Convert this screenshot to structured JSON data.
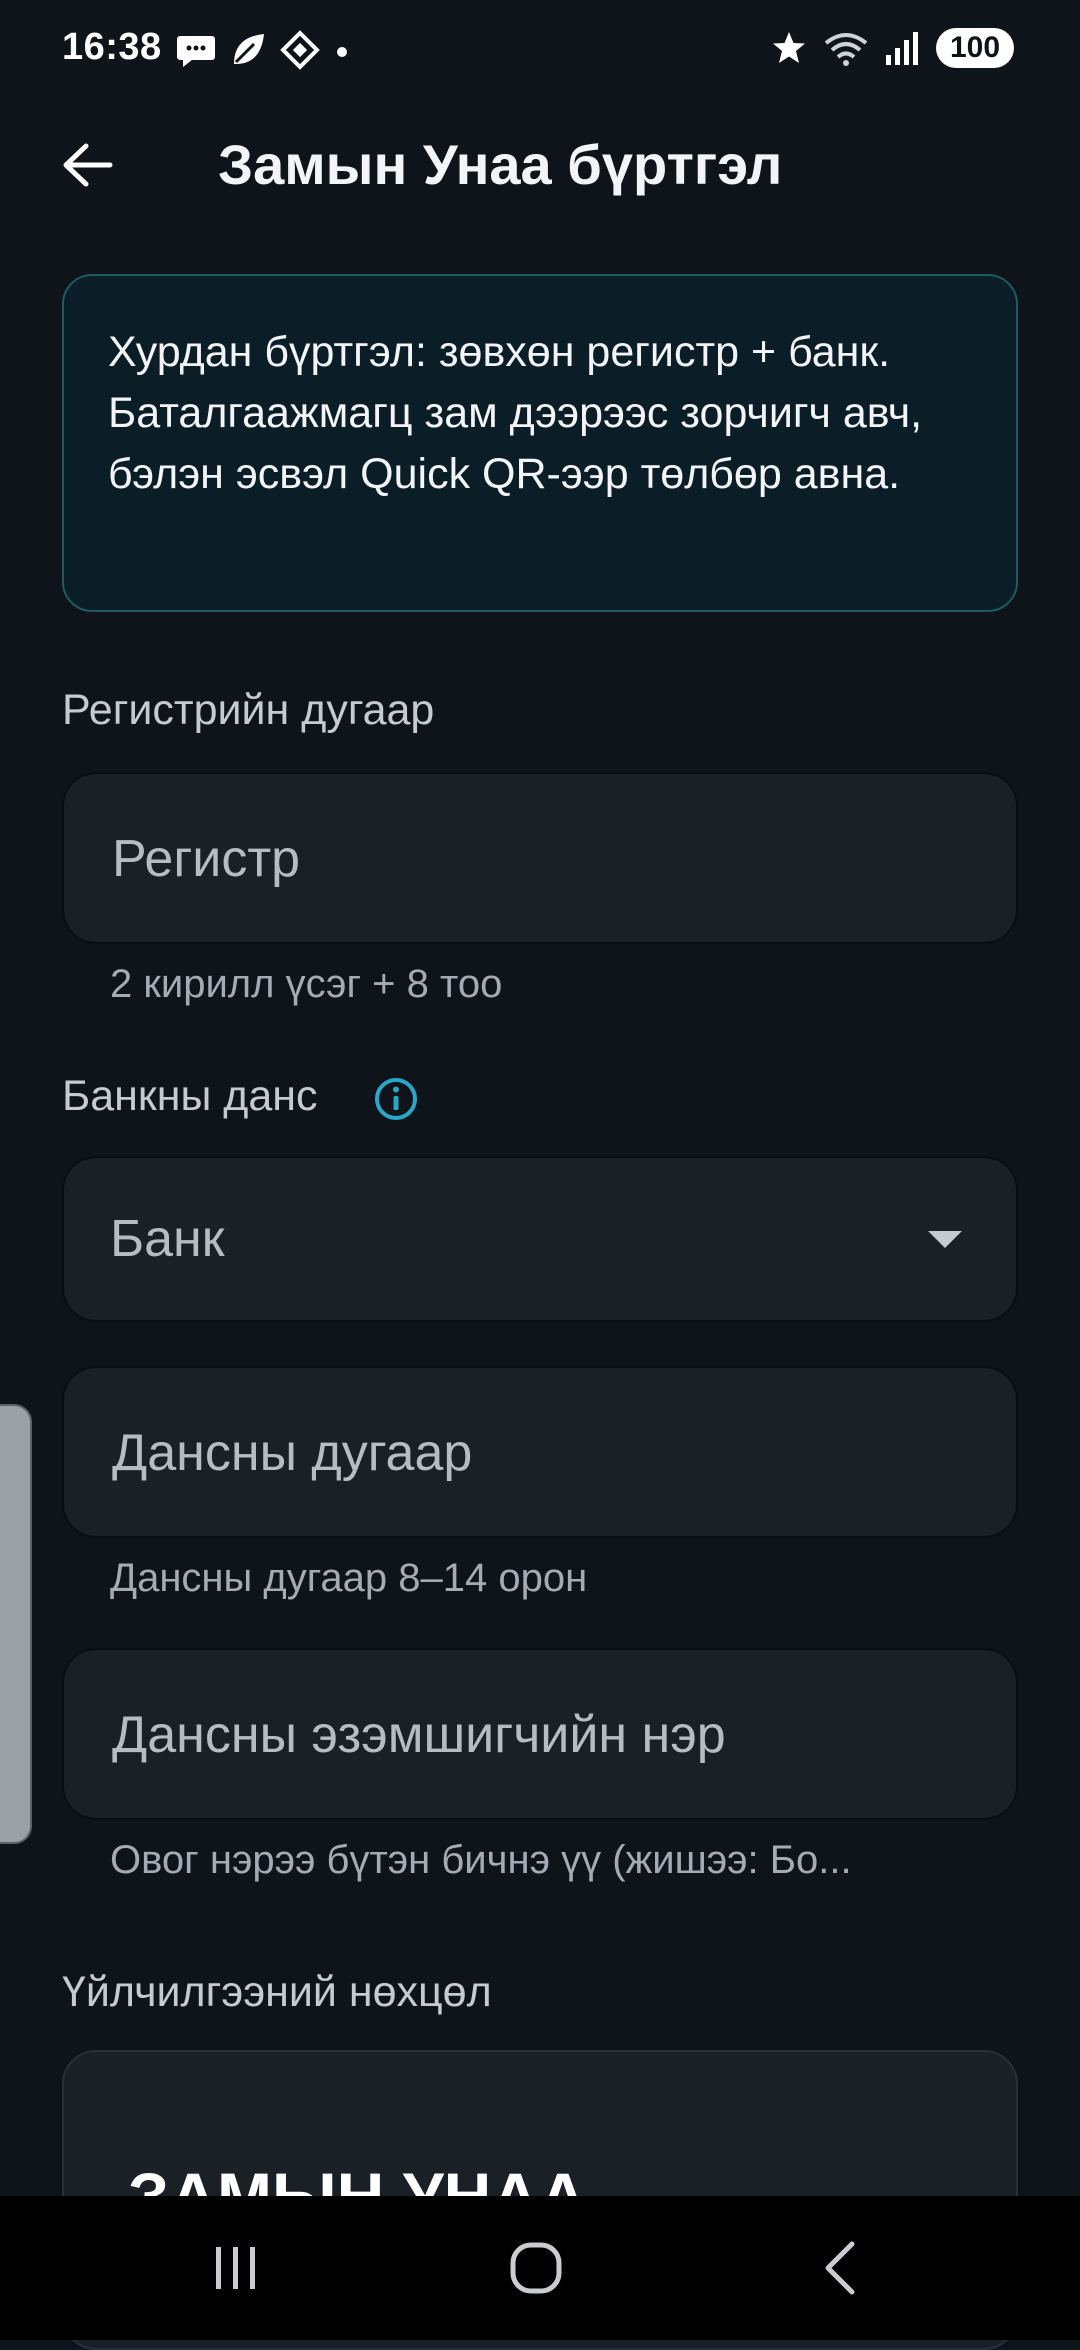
{
  "status_bar": {
    "time": "16:38",
    "battery": "100",
    "icons_left": [
      "chat-bubble-icon",
      "leaf-icon",
      "diamond-app-icon",
      "dot-icon"
    ],
    "icons_right": [
      "star-icon",
      "wifi-icon",
      "signal-icon"
    ]
  },
  "header": {
    "title": "Замын Унаа бүртгэл",
    "back_icon": "arrow-left-icon"
  },
  "info_banner": {
    "text": "Хурдан бүртгэл: зөвхөн регистр + банк. Баталгаажмагц зам дээрээс зорчигч авч, бэлэн эсвэл Quick QR-ээр төлбөр авна."
  },
  "registration": {
    "label": "Регистрийн дугаар",
    "placeholder": "Регистр",
    "value": "",
    "helper": "2 кирилл үсэг + 8 тоо"
  },
  "bank_section": {
    "label": "Банкны данс",
    "info_icon": "info-circle-icon",
    "bank_select": {
      "selected": "Банк",
      "icon": "caret-down-icon"
    },
    "account_number": {
      "placeholder": "Дансны дугаар",
      "value": "",
      "helper": "Дансны дугаар 8–14 орон"
    },
    "account_holder": {
      "placeholder": "Дансны эзэмшигчийн нэр",
      "value": "",
      "helper": "Овог нэрээ бүтэн бичнэ үү (жишээ: Бо..."
    }
  },
  "terms": {
    "label": "Үйлчилгээний нөхцөл",
    "heading": "ЗАМЫН УНАА —"
  },
  "nav_bar": {
    "icons": [
      "recent-apps-icon",
      "home-icon",
      "back-chevron-icon"
    ]
  },
  "colors": {
    "background": "#0f141a",
    "card_background": "#0b1e27",
    "card_border": "#1f5a62",
    "field_background": "#1b1f26",
    "accent_info": "#2aa6c9"
  }
}
